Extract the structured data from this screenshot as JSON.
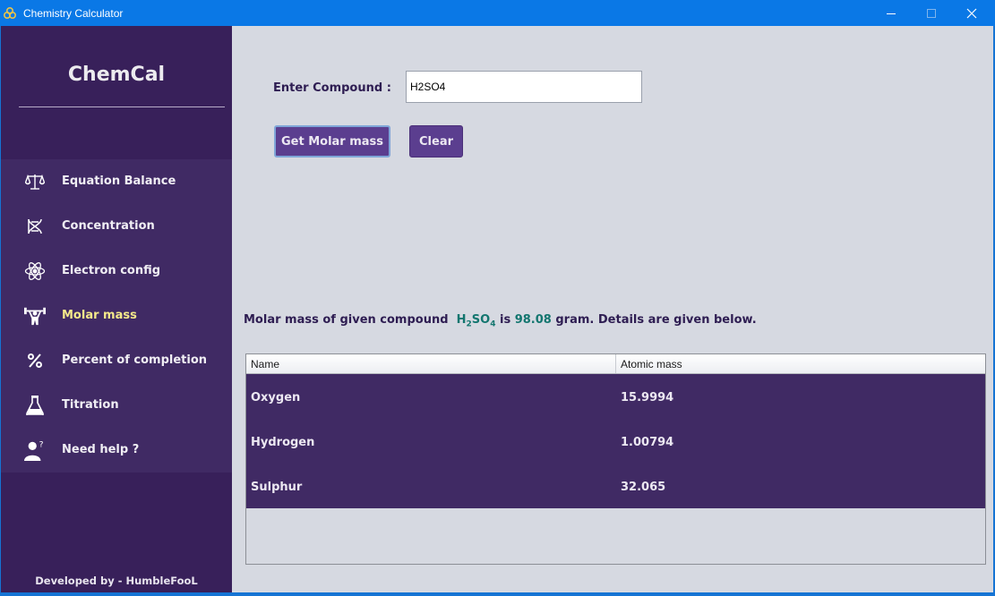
{
  "window": {
    "title": "Chemistry Calculator"
  },
  "sidebar": {
    "brand": "ChemCal",
    "items": [
      {
        "label": "Equation Balance",
        "icon": "balance-scale-icon"
      },
      {
        "label": "Concentration",
        "icon": "dna-icon"
      },
      {
        "label": "Electron config",
        "icon": "atom-icon"
      },
      {
        "label": "Molar mass",
        "icon": "weightlifter-icon",
        "active": true
      },
      {
        "label": "Percent of completion",
        "icon": "percent-icon"
      },
      {
        "label": "Titration",
        "icon": "flask-icon"
      },
      {
        "label": "Need help ?",
        "icon": "help-person-icon"
      }
    ],
    "footer": "Developed by - HumbleFooL"
  },
  "form": {
    "compound_label": "Enter Compound :",
    "compound_value": "H2SO4",
    "molar_button": "Get Molar mass",
    "clear_button": "Clear"
  },
  "result": {
    "prefix": "Molar mass of given compound",
    "formula_h": "H",
    "formula_h_sub": "2",
    "formula_so": "SO",
    "formula_so_sub": "4",
    "is": "is",
    "mass": "98.08",
    "suffix": "gram. Details are given below."
  },
  "table": {
    "columns": [
      "Name",
      "Atomic mass"
    ],
    "rows": [
      {
        "name": "Oxygen",
        "mass": "15.9994"
      },
      {
        "name": "Hydrogen",
        "mass": "1.00794"
      },
      {
        "name": "Sulphur",
        "mass": "32.065"
      }
    ]
  },
  "colors": {
    "sidebar": "#38205a",
    "menu": "#402a64",
    "active_text": "#f5e98a",
    "button": "#5b3e8f",
    "result_accent": "#13766f",
    "titlebar": "#0a78e6"
  }
}
